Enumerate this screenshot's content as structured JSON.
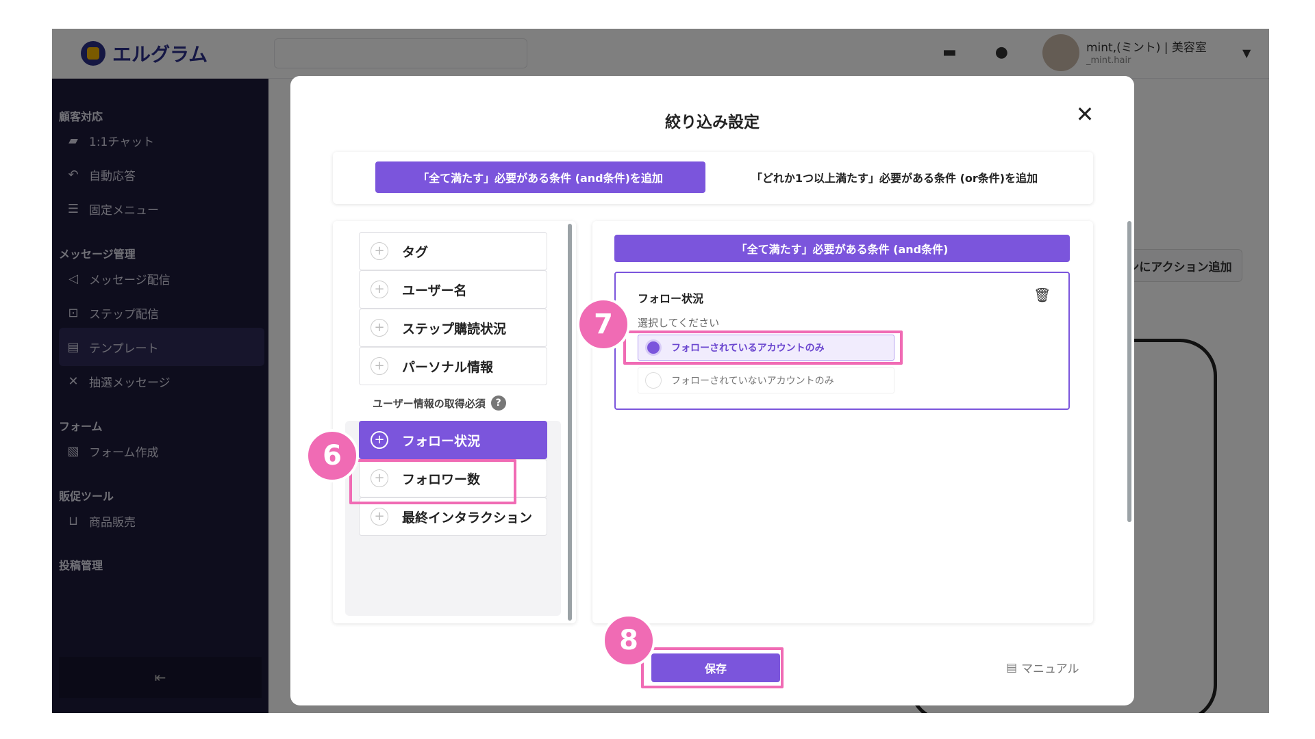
{
  "app": {
    "logo_text": "エルグラム",
    "user_name": "mint,(ミント) | 美容室",
    "user_id": "_mint.hair"
  },
  "sidebar": {
    "sections": [
      {
        "label": "顧客対応"
      },
      {
        "label": "メッセージ管理"
      },
      {
        "label": "フォーム"
      },
      {
        "label": "販促ツール"
      },
      {
        "label": "投稿管理"
      }
    ],
    "items": [
      {
        "label": "1:1チャット",
        "icon": "chat-icon"
      },
      {
        "label": "自動応答",
        "icon": "reply-icon"
      },
      {
        "label": "固定メニュー",
        "icon": "menu-icon"
      },
      {
        "label": "メッセージ配信",
        "icon": "send-icon"
      },
      {
        "label": "ステップ配信",
        "icon": "step-icon"
      },
      {
        "label": "テンプレート",
        "icon": "template-icon"
      },
      {
        "label": "抽選メッセージ",
        "icon": "shuffle-icon"
      },
      {
        "label": "フォーム作成",
        "icon": "form-icon"
      },
      {
        "label": "商品販売",
        "icon": "cart-icon"
      }
    ]
  },
  "background": {
    "action_button": "タンにアクション追加"
  },
  "modal": {
    "title": "絞り込み設定",
    "tabs": [
      {
        "label": "「全て満たす」必要がある条件 (and条件)を追加",
        "active": true
      },
      {
        "label": "「どれか1つ以上満たす」必要がある条件 (or条件)を追加",
        "active": false
      }
    ],
    "conditions": [
      {
        "label": "タグ"
      },
      {
        "label": "ユーザー名"
      },
      {
        "label": "ステップ購読状況"
      },
      {
        "label": "パーソナル情報"
      }
    ],
    "user_info_heading": "ユーザー情報の取得必須",
    "user_info_conditions": [
      {
        "label": "フォロー状況",
        "selected": true
      },
      {
        "label": "フォロワー数",
        "selected": false
      },
      {
        "label": "最終インタラクション",
        "selected": false
      }
    ],
    "right_header": "「全て満たす」必要がある条件 (and条件)",
    "condition_card": {
      "title": "フォロー状況",
      "hint": "選択してください",
      "options": [
        {
          "label": "フォローされているアカウントのみ",
          "checked": true
        },
        {
          "label": "フォローされていないアカウントのみ",
          "checked": false
        }
      ]
    },
    "save_label": "保存",
    "manual_label": "マニュアル"
  },
  "steps": [
    "6",
    "7",
    "8"
  ],
  "colors": {
    "accent": "#7b55dc",
    "highlight": "#f06bb4",
    "sidebar": "#1c1a3a"
  }
}
